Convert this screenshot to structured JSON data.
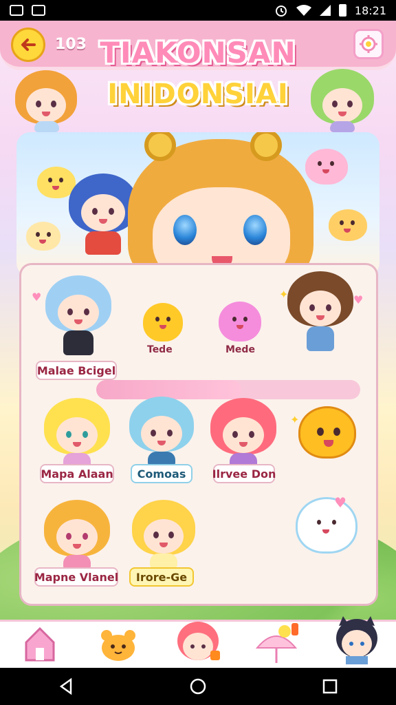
{
  "status_bar": {
    "time": "18:21",
    "left_icons": [
      "gallery-icon",
      "message-icon"
    ],
    "right_icons": [
      "alarm-icon",
      "wifi-icon",
      "signal-icon",
      "battery-icon"
    ]
  },
  "header": {
    "coin_count": "103",
    "title_line1": "TIAKONSAN",
    "title_line2": "INIDONSIAI",
    "back_icon": "back-arrow-icon",
    "settings_icon": "gear-icon"
  },
  "collection": {
    "row1": [
      {
        "label": "Tede"
      },
      {
        "label": "Mede"
      }
    ],
    "row1_name": "Malae Bcigel",
    "progress": 0.55,
    "row2": [
      {
        "label": "Mapa Alaan",
        "style": "pink"
      },
      {
        "label": "Comoas",
        "style": "blue"
      },
      {
        "label": "Ilrvee Don",
        "style": "pink"
      }
    ],
    "row3": [
      {
        "label": "Mapne Vlanel",
        "style": "pink"
      },
      {
        "label": "Irore-Ge",
        "style": "yellow"
      }
    ]
  },
  "bottom_nav": [
    {
      "name": "home",
      "icon": "house-icon"
    },
    {
      "name": "pets",
      "icon": "bear-icon"
    },
    {
      "name": "friends",
      "icon": "character-icon"
    },
    {
      "name": "shop",
      "icon": "umbrella-icon"
    },
    {
      "name": "profile",
      "icon": "avatar-icon"
    }
  ],
  "system_nav": [
    "back-icon",
    "home-icon",
    "recents-icon"
  ],
  "colors": {
    "top_bar": "#f7b4cf",
    "title_pink": "#ff8bb8",
    "title_yellow": "#ffd23a",
    "panel_border": "#e7b6c5"
  }
}
